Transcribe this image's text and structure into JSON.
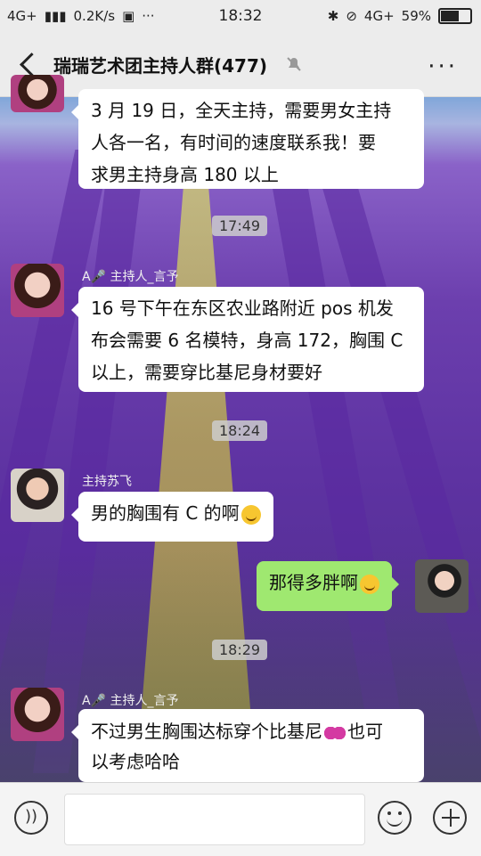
{
  "status_bar": {
    "network": "4G+",
    "speed": "0.2K/s",
    "time": "18:32",
    "network_right": "4G+",
    "battery": "59%"
  },
  "header": {
    "title": "瑞瑞艺术团主持人群(477)"
  },
  "messages": [
    {
      "type": "text",
      "side": "left",
      "text_lines": [
        "3 月 19 日，全天主持，需要男女主持",
        "人各一名，有时间的速度联系我！要",
        "求男主持身高 180 以上"
      ]
    },
    {
      "type": "time",
      "text": "17:49"
    },
    {
      "type": "text",
      "side": "left",
      "sender": "A🎤 主持人_言予",
      "text_lines": [
        "16 号下午在东区农业路附近 pos 机发",
        "布会需要 6 名模特，身高 172，胸围 C",
        "以上，需要穿比基尼身材要好"
      ]
    },
    {
      "type": "time",
      "text": "18:24"
    },
    {
      "type": "text",
      "side": "left",
      "sender": "主持苏飞",
      "text": "男的胸围有 C 的啊"
    },
    {
      "type": "text",
      "side": "right",
      "text": "那得多胖啊"
    },
    {
      "type": "time",
      "text": "18:29"
    },
    {
      "type": "text",
      "side": "left",
      "sender": "A🎤 主持人_言予",
      "text_lines": [
        "不过男生胸围达标穿个比基尼",
        "以考虑哈哈"
      ],
      "suffix": "也可"
    }
  ],
  "colors": {
    "green_bubble": "#9fe870",
    "bar_bg": "#ececec"
  }
}
